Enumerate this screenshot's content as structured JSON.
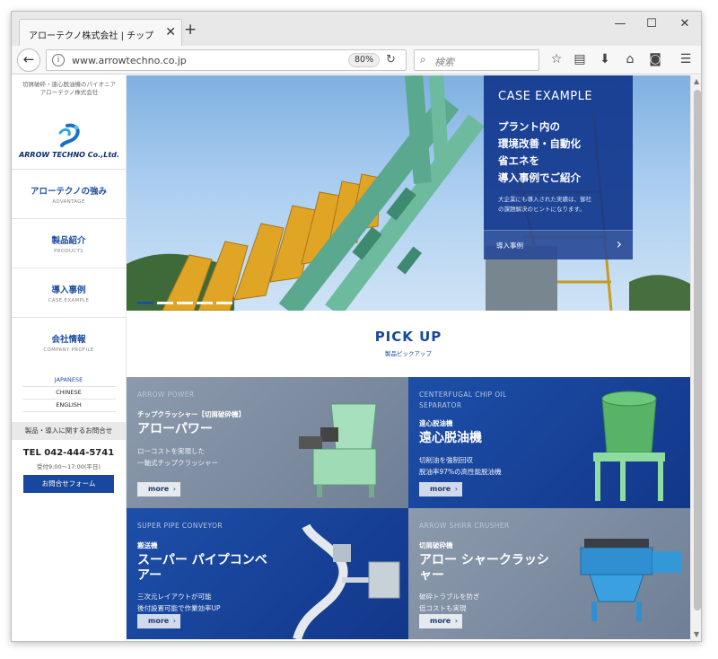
{
  "browser": {
    "tab_title": "アローテクノ株式会社 | チップクラッシ",
    "url": "www.arrowtechno.co.jp",
    "zoom": "80%",
    "search_placeholder": "検索"
  },
  "sidebar": {
    "tagline_line1": "切屑破砕・遠心脱油機のパイオニア",
    "tagline_line2": "アローテクノ株式会社",
    "logo_text": "ARROW TECHNO Co.,Ltd.",
    "nav": [
      {
        "jp": "アローテクノの強み",
        "en": "ADVANTAGE"
      },
      {
        "jp": "製品紹介",
        "en": "PRODUCTS"
      },
      {
        "jp": "導入事例",
        "en": "CASE EXAMPLE"
      },
      {
        "jp": "会社情報",
        "en": "COMPANY PROFILE"
      }
    ],
    "languages": [
      "JAPANESE",
      "CHINESE",
      "ENGLISH"
    ],
    "contact_heading": "製品・導入に関するお問合せ",
    "tel": "TEL 042-444-5741",
    "hours": "受付9:00～17:00(平日)",
    "contact_button": "お問合せフォーム"
  },
  "hero": {
    "case_label": "CASE EXAMPLE",
    "heading_lines": [
      "プラント内の",
      "環境改善・自動化",
      "省エネを",
      "導入事例でご紹介"
    ],
    "desc_line1": "大企業にも導入された実績は、御社",
    "desc_line2": "の課題解決のヒントになります。",
    "link_label": "導入事例",
    "slides": 5,
    "active_slide": 1
  },
  "pickup": {
    "title": "PICK UP",
    "subtitle": "製品ピックアップ",
    "more_label": "more",
    "cards": [
      {
        "en": "ARROW POWER",
        "category": "チップクラッシャー【切屑破砕機】",
        "name": "アローパワー",
        "desc": [
          "ローコストを実現した",
          "一軸式チップクラッシャー"
        ]
      },
      {
        "en": "CENTERFUGAL CHIP OIL SEPARATOR",
        "category": "遠心脱油機",
        "name": "遠心脱油機",
        "desc": [
          "切削油を強制回収",
          "脱油率97%の高性能脱油機"
        ]
      },
      {
        "en": "SUPER PIPE CONVEYOR",
        "category": "搬送機",
        "name": "スーパー パイプコンベアー",
        "desc": [
          "三次元レイアウトが可能",
          "後付設置可能で作業効率UP"
        ]
      },
      {
        "en": "ARROW SHIRR CRUSHER",
        "category": "切屑破砕機",
        "name": "アロー シャークラッシャー",
        "desc": [
          "破砕トラブルを防ぎ",
          "低コストも実現"
        ]
      }
    ]
  },
  "colors": {
    "brand_blue": "#17479e",
    "nav_text": "#1e4ea0"
  }
}
